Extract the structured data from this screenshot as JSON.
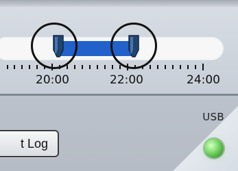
{
  "timeline": {
    "labels": [
      "20:00",
      "22:00",
      "24:00"
    ]
  },
  "actions": {
    "log_button_label": "t Log"
  },
  "status": {
    "usb_label": "USB",
    "usb_led_color": "#8fe77d"
  },
  "icons": {
    "left_handle": "left-handle-icon",
    "right_handle": "right-handle-icon",
    "led": "status-led-icon"
  }
}
